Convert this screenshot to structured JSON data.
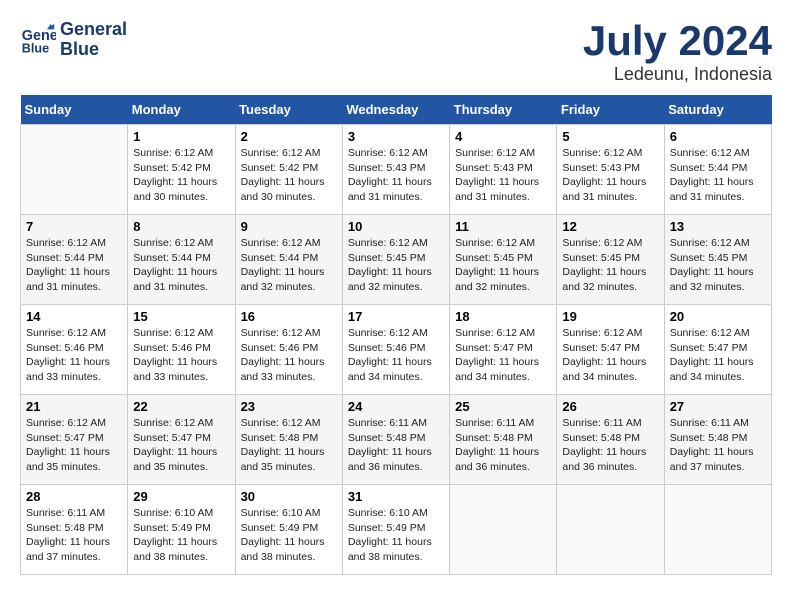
{
  "header": {
    "logo_line1": "General",
    "logo_line2": "Blue",
    "month": "July 2024",
    "location": "Ledeunu, Indonesia"
  },
  "days_of_week": [
    "Sunday",
    "Monday",
    "Tuesday",
    "Wednesday",
    "Thursday",
    "Friday",
    "Saturday"
  ],
  "weeks": [
    [
      {
        "day": "",
        "info": ""
      },
      {
        "day": "1",
        "info": "Sunrise: 6:12 AM\nSunset: 5:42 PM\nDaylight: 11 hours\nand 30 minutes."
      },
      {
        "day": "2",
        "info": "Sunrise: 6:12 AM\nSunset: 5:42 PM\nDaylight: 11 hours\nand 30 minutes."
      },
      {
        "day": "3",
        "info": "Sunrise: 6:12 AM\nSunset: 5:43 PM\nDaylight: 11 hours\nand 31 minutes."
      },
      {
        "day": "4",
        "info": "Sunrise: 6:12 AM\nSunset: 5:43 PM\nDaylight: 11 hours\nand 31 minutes."
      },
      {
        "day": "5",
        "info": "Sunrise: 6:12 AM\nSunset: 5:43 PM\nDaylight: 11 hours\nand 31 minutes."
      },
      {
        "day": "6",
        "info": "Sunrise: 6:12 AM\nSunset: 5:44 PM\nDaylight: 11 hours\nand 31 minutes."
      }
    ],
    [
      {
        "day": "7",
        "info": "Sunrise: 6:12 AM\nSunset: 5:44 PM\nDaylight: 11 hours\nand 31 minutes."
      },
      {
        "day": "8",
        "info": "Sunrise: 6:12 AM\nSunset: 5:44 PM\nDaylight: 11 hours\nand 31 minutes."
      },
      {
        "day": "9",
        "info": "Sunrise: 6:12 AM\nSunset: 5:44 PM\nDaylight: 11 hours\nand 32 minutes."
      },
      {
        "day": "10",
        "info": "Sunrise: 6:12 AM\nSunset: 5:45 PM\nDaylight: 11 hours\nand 32 minutes."
      },
      {
        "day": "11",
        "info": "Sunrise: 6:12 AM\nSunset: 5:45 PM\nDaylight: 11 hours\nand 32 minutes."
      },
      {
        "day": "12",
        "info": "Sunrise: 6:12 AM\nSunset: 5:45 PM\nDaylight: 11 hours\nand 32 minutes."
      },
      {
        "day": "13",
        "info": "Sunrise: 6:12 AM\nSunset: 5:45 PM\nDaylight: 11 hours\nand 32 minutes."
      }
    ],
    [
      {
        "day": "14",
        "info": "Sunrise: 6:12 AM\nSunset: 5:46 PM\nDaylight: 11 hours\nand 33 minutes."
      },
      {
        "day": "15",
        "info": "Sunrise: 6:12 AM\nSunset: 5:46 PM\nDaylight: 11 hours\nand 33 minutes."
      },
      {
        "day": "16",
        "info": "Sunrise: 6:12 AM\nSunset: 5:46 PM\nDaylight: 11 hours\nand 33 minutes."
      },
      {
        "day": "17",
        "info": "Sunrise: 6:12 AM\nSunset: 5:46 PM\nDaylight: 11 hours\nand 34 minutes."
      },
      {
        "day": "18",
        "info": "Sunrise: 6:12 AM\nSunset: 5:47 PM\nDaylight: 11 hours\nand 34 minutes."
      },
      {
        "day": "19",
        "info": "Sunrise: 6:12 AM\nSunset: 5:47 PM\nDaylight: 11 hours\nand 34 minutes."
      },
      {
        "day": "20",
        "info": "Sunrise: 6:12 AM\nSunset: 5:47 PM\nDaylight: 11 hours\nand 34 minutes."
      }
    ],
    [
      {
        "day": "21",
        "info": "Sunrise: 6:12 AM\nSunset: 5:47 PM\nDaylight: 11 hours\nand 35 minutes."
      },
      {
        "day": "22",
        "info": "Sunrise: 6:12 AM\nSunset: 5:47 PM\nDaylight: 11 hours\nand 35 minutes."
      },
      {
        "day": "23",
        "info": "Sunrise: 6:12 AM\nSunset: 5:48 PM\nDaylight: 11 hours\nand 35 minutes."
      },
      {
        "day": "24",
        "info": "Sunrise: 6:11 AM\nSunset: 5:48 PM\nDaylight: 11 hours\nand 36 minutes."
      },
      {
        "day": "25",
        "info": "Sunrise: 6:11 AM\nSunset: 5:48 PM\nDaylight: 11 hours\nand 36 minutes."
      },
      {
        "day": "26",
        "info": "Sunrise: 6:11 AM\nSunset: 5:48 PM\nDaylight: 11 hours\nand 36 minutes."
      },
      {
        "day": "27",
        "info": "Sunrise: 6:11 AM\nSunset: 5:48 PM\nDaylight: 11 hours\nand 37 minutes."
      }
    ],
    [
      {
        "day": "28",
        "info": "Sunrise: 6:11 AM\nSunset: 5:48 PM\nDaylight: 11 hours\nand 37 minutes."
      },
      {
        "day": "29",
        "info": "Sunrise: 6:10 AM\nSunset: 5:49 PM\nDaylight: 11 hours\nand 38 minutes."
      },
      {
        "day": "30",
        "info": "Sunrise: 6:10 AM\nSunset: 5:49 PM\nDaylight: 11 hours\nand 38 minutes."
      },
      {
        "day": "31",
        "info": "Sunrise: 6:10 AM\nSunset: 5:49 PM\nDaylight: 11 hours\nand 38 minutes."
      },
      {
        "day": "",
        "info": ""
      },
      {
        "day": "",
        "info": ""
      },
      {
        "day": "",
        "info": ""
      }
    ]
  ]
}
